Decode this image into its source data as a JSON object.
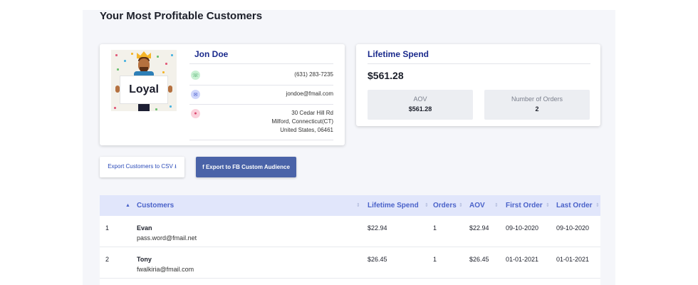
{
  "page": {
    "title": "Your Most Profitable Customers"
  },
  "customer_card": {
    "image_caption": "Loyal",
    "name": "Jon Doe",
    "phone": "(631) 283-7235",
    "email": "jondoe@fmail.com",
    "address_line1": "30 Cedar Hill Rd",
    "address_line2": "Milford, Connecticut(CT)",
    "address_line3": "United States, 06461",
    "icons": {
      "phone": "phone-icon",
      "email": "envelope-icon",
      "location": "map-pin-icon"
    }
  },
  "spend_card": {
    "title": "Lifetime Spend",
    "value": "$561.28",
    "aov_label": "AOV",
    "aov_value": "$561.28",
    "orders_label": "Number of Orders",
    "orders_value": "2"
  },
  "actions": {
    "export_csv": "Export Customers to CSV ⭳",
    "export_fb": "f Export to FB Custom Audience"
  },
  "table": {
    "headers": {
      "customers": "Customers",
      "lifetime_spend": "Lifetime Spend",
      "orders": "Orders",
      "aov": "AOV",
      "first_order": "First Order",
      "last_order": "Last Order"
    },
    "rows": [
      {
        "index": "1",
        "name": "Evan",
        "email": "pass.word@fmail.net",
        "lifetime_spend": "$22.94",
        "orders": "1",
        "aov": "$22.94",
        "first_order": "09-10-2020",
        "last_order": "09-10-2020"
      },
      {
        "index": "2",
        "name": "Tony",
        "email": "fwalkiria@fmail.com",
        "lifetime_spend": "$26.45",
        "orders": "1",
        "aov": "$26.45",
        "first_order": "01-01-2021",
        "last_order": "01-01-2021"
      }
    ]
  },
  "colors": {
    "accent": "#1a2a8c",
    "header_bg": "#e1e6fb",
    "fb_button": "#4a63a8"
  }
}
